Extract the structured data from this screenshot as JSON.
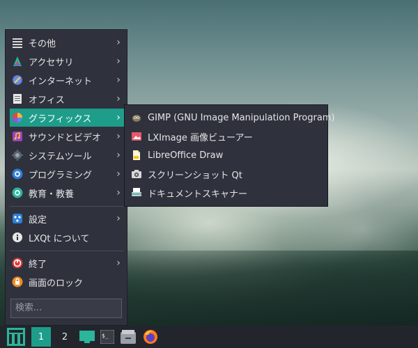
{
  "menu": {
    "items": [
      {
        "label": "その他",
        "icon": "list-icon"
      },
      {
        "label": "アクセサリ",
        "icon": "accessories-icon"
      },
      {
        "label": "インターネット",
        "icon": "internet-icon"
      },
      {
        "label": "オフィス",
        "icon": "office-icon"
      },
      {
        "label": "グラフィックス",
        "icon": "graphics-icon"
      },
      {
        "label": "サウンドとビデオ",
        "icon": "multimedia-icon"
      },
      {
        "label": "システムツール",
        "icon": "system-tools-icon"
      },
      {
        "label": "プログラミング",
        "icon": "programming-icon"
      },
      {
        "label": "教育・教養",
        "icon": "education-icon"
      },
      {
        "label": "設定",
        "icon": "settings-icon"
      },
      {
        "label": "LXQt について",
        "icon": "info-icon"
      },
      {
        "label": "終了",
        "icon": "power-icon"
      },
      {
        "label": "画面のロック",
        "icon": "lock-icon"
      }
    ],
    "search_placeholder": "検索..."
  },
  "submenu": {
    "items": [
      {
        "label": "GIMP (GNU Image Manipulation Program)",
        "icon": "gimp-icon"
      },
      {
        "label": "LXImage 画像ビューアー",
        "icon": "image-viewer-icon"
      },
      {
        "label": "LibreOffice Draw",
        "icon": "libreoffice-draw-icon"
      },
      {
        "label": "スクリーンショット Qt",
        "icon": "camera-icon"
      },
      {
        "label": "ドキュメントスキャナー",
        "icon": "scanner-icon"
      }
    ]
  },
  "taskbar": {
    "workspaces": [
      "1",
      "2"
    ]
  },
  "colors": {
    "accent": "#1e9d8a",
    "menu_bg": "#2f323d",
    "taskbar_bg": "#23252d"
  }
}
